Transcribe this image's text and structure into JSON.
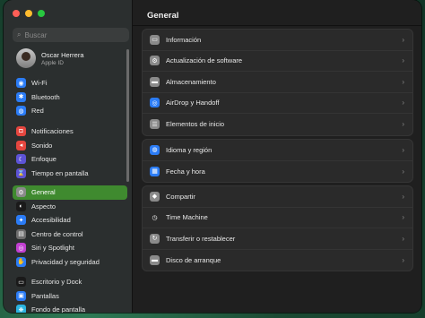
{
  "colors": {
    "close": "#ff5f57",
    "minimize": "#febc2e",
    "maximize": "#28c840",
    "active": "#3f8a2f"
  },
  "search": {
    "placeholder": "Buscar",
    "icon": "search-icon"
  },
  "user": {
    "name": "Oscar Herrera",
    "sub": "Apple ID"
  },
  "sidebar": {
    "groups": [
      [
        {
          "label": "Wi-Fi",
          "icon": "wifi-icon",
          "color": "#2b7cf6",
          "glyph": "◉"
        },
        {
          "label": "Bluetooth",
          "icon": "bluetooth-icon",
          "color": "#2b7cf6",
          "glyph": "✱"
        },
        {
          "label": "Red",
          "icon": "globe-icon",
          "color": "#2b7cf6",
          "glyph": "◍"
        }
      ],
      [
        {
          "label": "Notificaciones",
          "icon": "bell-icon",
          "color": "#e5463f",
          "glyph": "◘"
        },
        {
          "label": "Sonido",
          "icon": "speaker-icon",
          "color": "#e5463f",
          "glyph": "◂"
        },
        {
          "label": "Enfoque",
          "icon": "moon-icon",
          "color": "#5d53d6",
          "glyph": "☾"
        },
        {
          "label": "Tiempo en pantalla",
          "icon": "hourglass-icon",
          "color": "#5d53d6",
          "glyph": "⌛"
        }
      ],
      [
        {
          "label": "General",
          "icon": "gear-icon",
          "color": "#8a8a8a",
          "glyph": "⚙",
          "active": true
        },
        {
          "label": "Aspecto",
          "icon": "appearance-icon",
          "color": "#1a1a1a",
          "glyph": "◐"
        },
        {
          "label": "Accesibilidad",
          "icon": "accessibility-icon",
          "color": "#2b7cf6",
          "glyph": "✦"
        },
        {
          "label": "Centro de control",
          "icon": "control-center-icon",
          "color": "#6e6e6e",
          "glyph": "▤"
        },
        {
          "label": "Siri y Spotlight",
          "icon": "siri-icon",
          "color": "#c13fd0",
          "glyph": "◎"
        },
        {
          "label": "Privacidad y seguridad",
          "icon": "hand-icon",
          "color": "#2b7cf6",
          "glyph": "✋"
        }
      ],
      [
        {
          "label": "Escritorio y Dock",
          "icon": "dock-icon",
          "color": "#1a1a1a",
          "glyph": "▭"
        },
        {
          "label": "Pantallas",
          "icon": "display-icon",
          "color": "#2b7cf6",
          "glyph": "▣"
        },
        {
          "label": "Fondo de pantalla",
          "icon": "wallpaper-icon",
          "color": "#2bb4e0",
          "glyph": "❋"
        }
      ]
    ]
  },
  "main": {
    "title": "General",
    "groups": [
      [
        {
          "label": "Información",
          "icon": "info-icon",
          "color": "#8a8a8a",
          "glyph": "▭"
        },
        {
          "label": "Actualización de software",
          "icon": "software-update-icon",
          "color": "#8a8a8a",
          "glyph": "⚙"
        },
        {
          "label": "Almacenamiento",
          "icon": "storage-icon",
          "color": "#8a8a8a",
          "glyph": "▬"
        },
        {
          "label": "AirDrop y Handoff",
          "icon": "airdrop-icon",
          "color": "#2b7cf6",
          "glyph": "◎"
        },
        {
          "label": "Elementos de inicio",
          "icon": "login-items-icon",
          "color": "#8a8a8a",
          "glyph": "☰"
        }
      ],
      [
        {
          "label": "Idioma y región",
          "icon": "language-icon",
          "color": "#2b7cf6",
          "glyph": "◍"
        },
        {
          "label": "Fecha y hora",
          "icon": "calendar-icon",
          "color": "#2b7cf6",
          "glyph": "▦"
        }
      ],
      [
        {
          "label": "Compartir",
          "icon": "sharing-icon",
          "color": "#8a8a8a",
          "glyph": "◆"
        },
        {
          "label": "Time Machine",
          "icon": "time-machine-icon",
          "color": "#2a2a2a",
          "glyph": "◷"
        },
        {
          "label": "Transferir o restablecer",
          "icon": "transfer-icon",
          "color": "#8a8a8a",
          "glyph": "↻"
        },
        {
          "label": "Disco de arranque",
          "icon": "startup-disk-icon",
          "color": "#8a8a8a",
          "glyph": "▬"
        }
      ]
    ]
  }
}
